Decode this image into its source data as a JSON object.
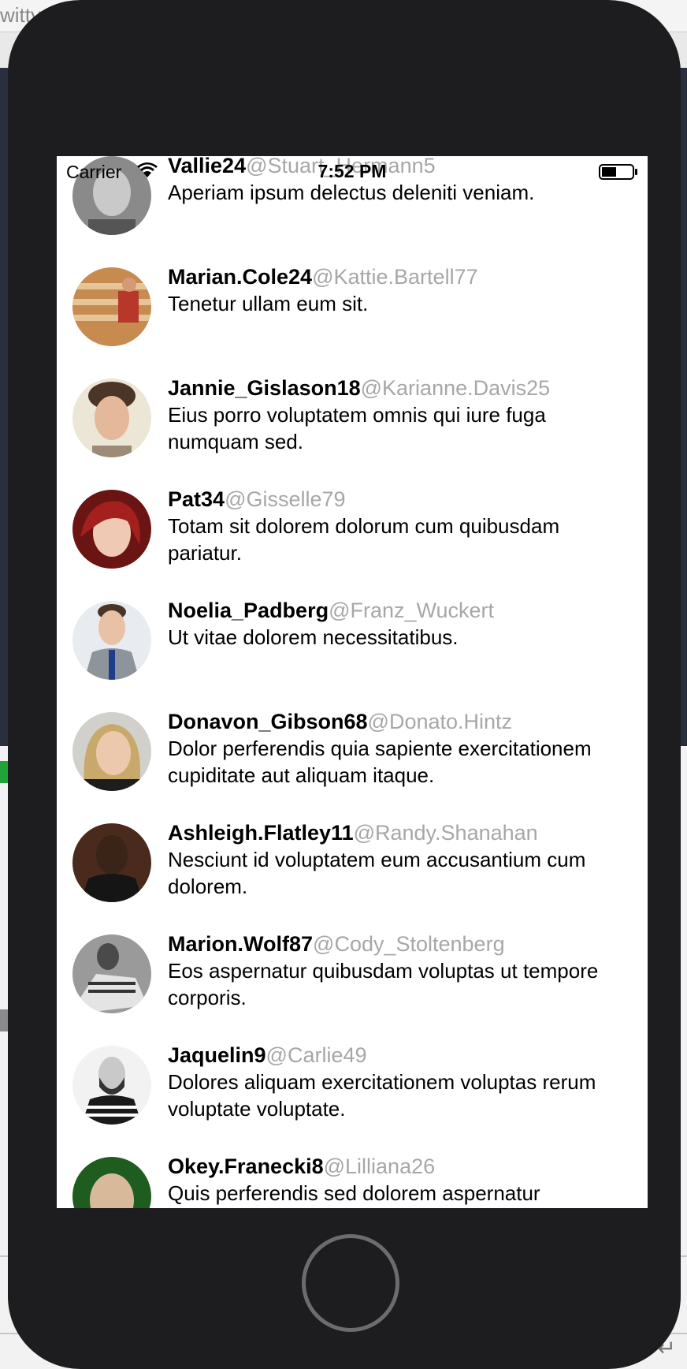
{
  "browser": {
    "url_fragment": "witty"
  },
  "status_bar": {
    "carrier": "Carrier",
    "time": "7:52 PM"
  },
  "tweets": [
    {
      "name": "Vallie24",
      "handle": "@Stuart_Hermann5",
      "text": "Aperiam ipsum delectus deleniti veniam.",
      "avatar": "avatar-bald-man-grayscale"
    },
    {
      "name": "Marian.Cole24",
      "handle": "@Kattie.Bartell77",
      "text": "Tenetur ullam eum sit.",
      "avatar": "avatar-man-on-stairs"
    },
    {
      "name": "Jannie_Gislason18",
      "handle": "@Karianne.Davis25",
      "text": "Eius porro voluptatem omnis qui iure fuga numquam sed.",
      "avatar": "avatar-young-man"
    },
    {
      "name": "Pat34",
      "handle": "@Gisselle79",
      "text": "Totam sit dolorem dolorum cum quibusdam pariatur.",
      "avatar": "avatar-red-haired-woman"
    },
    {
      "name": "Noelia_Padberg",
      "handle": "@Franz_Wuckert",
      "text": "Ut vitae dolorem necessitatibus.",
      "avatar": "avatar-man-in-suit"
    },
    {
      "name": "Donavon_Gibson68",
      "handle": "@Donato.Hintz",
      "text": "Dolor perferendis quia sapiente exercitationem cupiditate aut aliquam itaque.",
      "avatar": "avatar-blonde-woman"
    },
    {
      "name": "Ashleigh.Flatley11",
      "handle": "@Randy.Shanahan",
      "text": "Nesciunt id voluptatem eum accusantium cum dolorem.",
      "avatar": "avatar-smiling-man"
    },
    {
      "name": "Marion.Wolf87",
      "handle": "@Cody_Stoltenberg",
      "text": "Eos aspernatur quibusdam voluptas ut tempore corporis.",
      "avatar": "avatar-man-grayscale"
    },
    {
      "name": "Jaquelin9",
      "handle": "@Carlie49",
      "text": "Dolores aliquam exercitationem voluptas rerum voluptate voluptate.",
      "avatar": "avatar-bearded-man-striped-shirt"
    },
    {
      "name": "Okey.Franecki8",
      "handle": "@Lilliana26",
      "text": "Quis perferendis sed dolorem aspernatur",
      "avatar": "avatar-bald-man-green"
    }
  ],
  "colors": {
    "handle": "#a7a7a7",
    "phone_body": "#1d1d1f",
    "screen": "#ffffff"
  }
}
